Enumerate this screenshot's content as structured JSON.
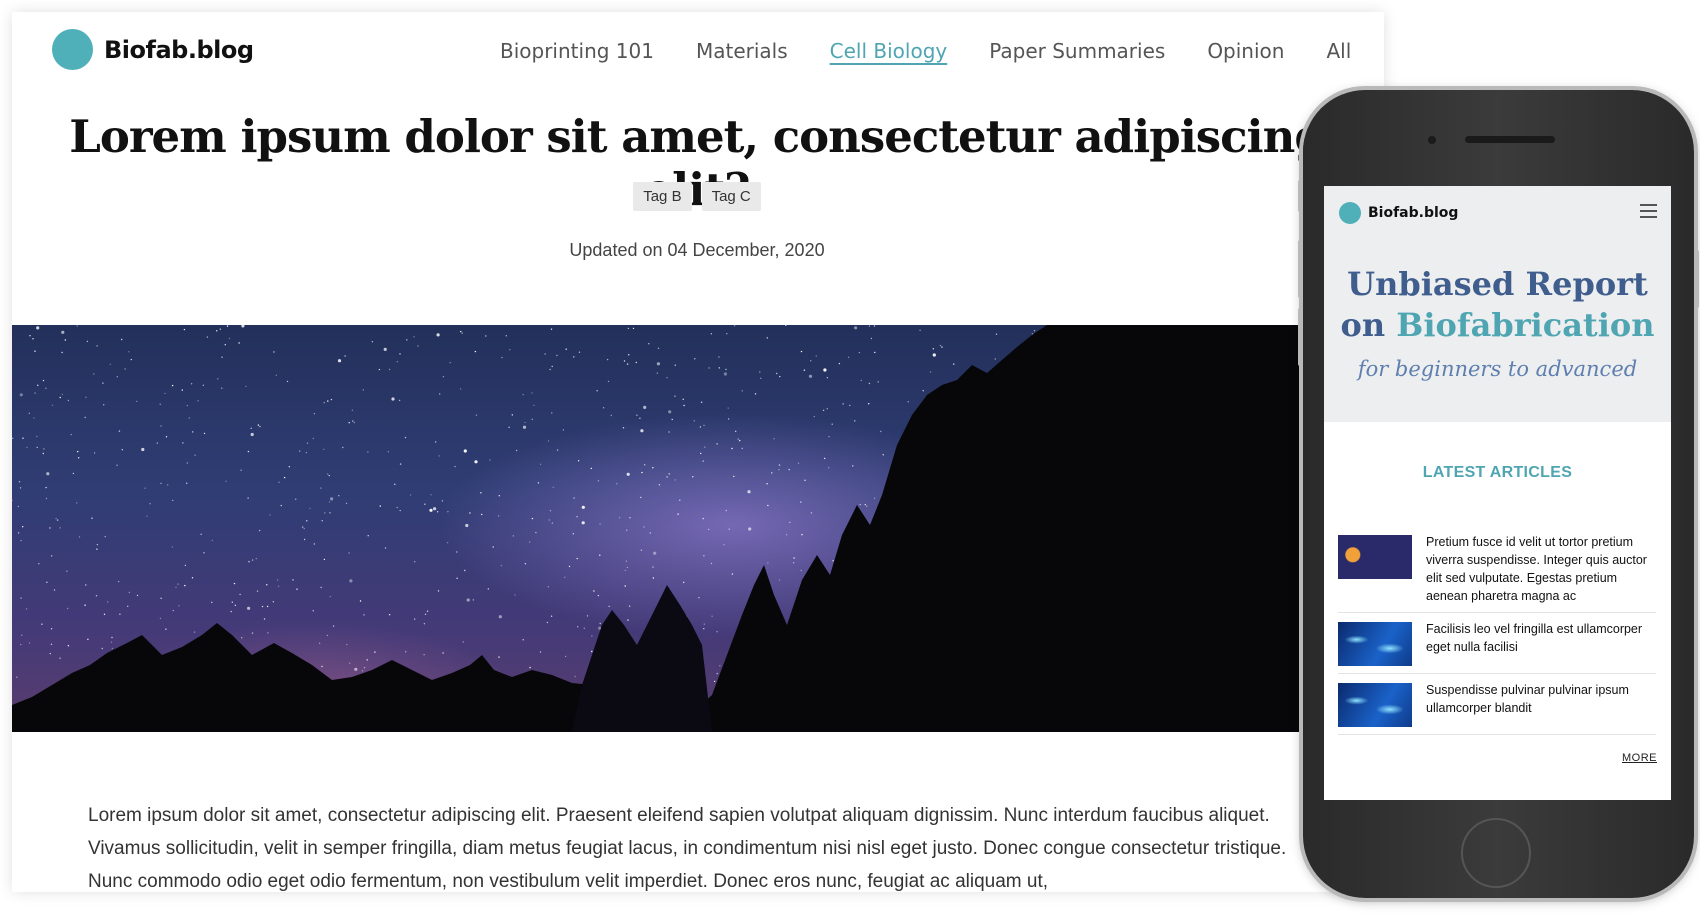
{
  "site": {
    "name": "Biofab.blog",
    "accent": "#4fb0ba"
  },
  "nav": {
    "items": [
      "Bioprinting 101",
      "Materials",
      "Cell Biology",
      "Paper Summaries",
      "Opinion",
      "All"
    ],
    "active": "Cell Biology"
  },
  "article": {
    "title": "Lorem ipsum dolor sit amet, consectetur adipiscing elit?",
    "tags": [
      "Tag B",
      "Tag C"
    ],
    "updated": "Updated on 04 December, 2020",
    "body": "Lorem ipsum dolor sit amet, consectetur adipiscing elit. Praesent eleifend sapien volutpat aliquam dignissim. Nunc interdum faucibus aliquet. Vivamus sollicitudin, velit in semper fringilla, diam metus feugiat lacus, in condimentum nisi nisl eget justo. Donec congue consectetur tristique. Nunc commodo odio eget odio fermentum, non vestibulum velit imperdiet. Donec eros nunc, feugiat ac aliquam ut,"
  },
  "mobile": {
    "brand": "Biofab.blog",
    "hero_line1": "Unbiased Report",
    "hero_on": "on",
    "hero_accent": "Biofabrication",
    "subtitle": "for beginners to advanced",
    "latest_heading": "LATEST ARTICLES",
    "articles": [
      "Pretium fusce id velit ut tortor pretium viverra suspendisse. Integer quis auctor elit sed vulputate. Egestas pretium aenean pharetra magna ac",
      "Facilisis leo vel fringilla est ullamcorper eget nulla facilisi",
      "Suspendisse pulvinar pulvinar ipsum ullamcorper blandit"
    ],
    "more_label": "MORE"
  }
}
